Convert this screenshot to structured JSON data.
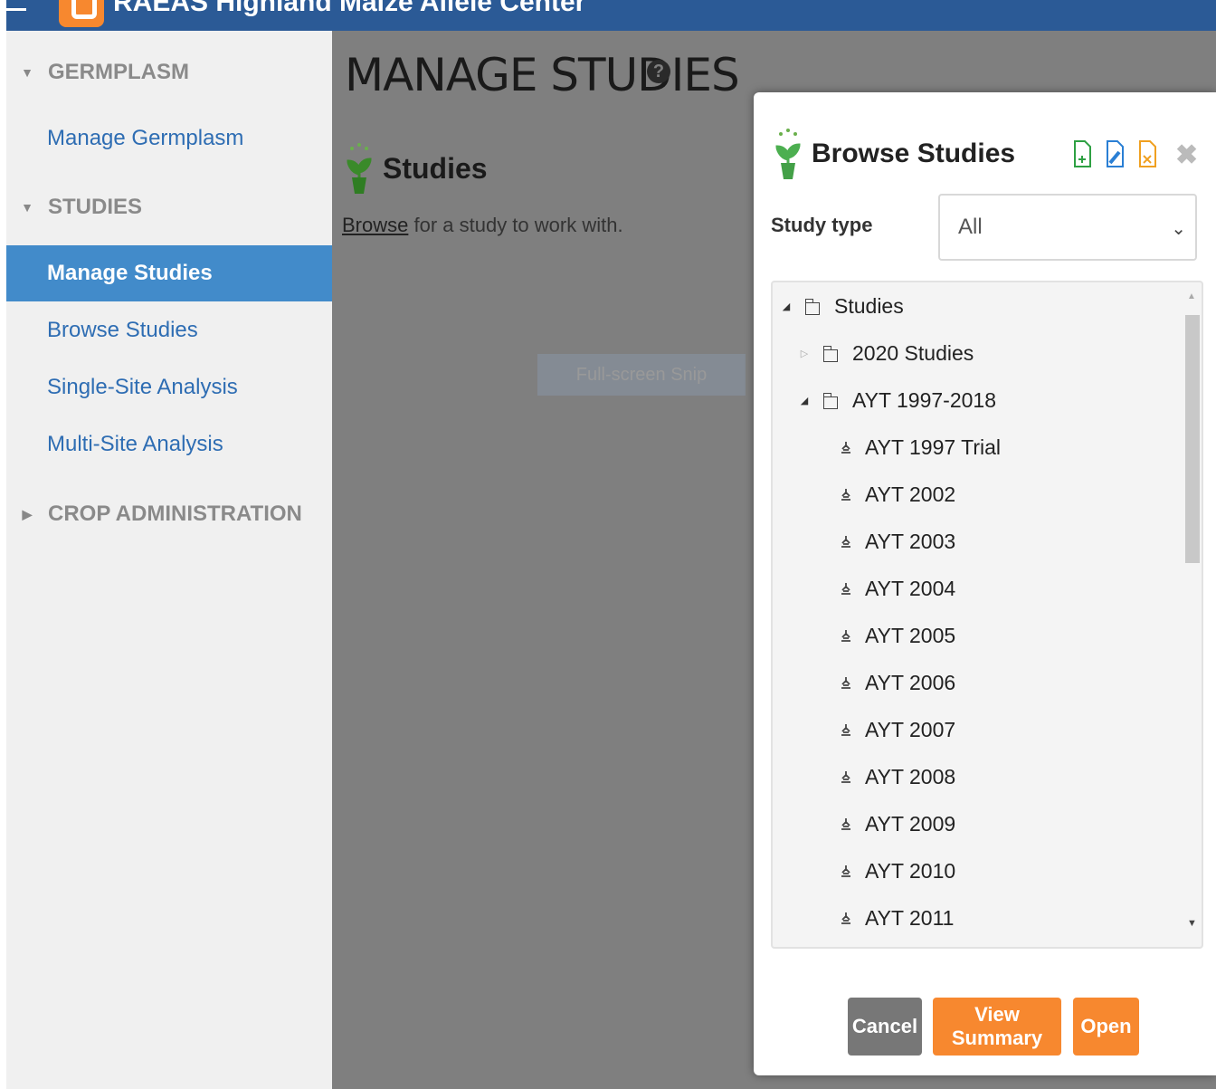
{
  "app": {
    "title": "RAEAS Highland Maize Allele Center"
  },
  "sidebar": {
    "sections": [
      {
        "label": "GERMPLASM",
        "expanded": true
      },
      {
        "label": "STUDIES",
        "expanded": true
      },
      {
        "label": "CROP ADMINISTRATION",
        "expanded": false
      }
    ],
    "links": [
      {
        "label": "Manage Germplasm",
        "active": false
      },
      {
        "label": "Manage Studies",
        "active": true
      },
      {
        "label": "Browse Studies",
        "active": false
      },
      {
        "label": "Single-Site Analysis",
        "active": false
      },
      {
        "label": "Multi-Site Analysis",
        "active": false
      }
    ]
  },
  "main": {
    "page_title": "MANAGE STUDIES",
    "help_icon": "question-circle-icon",
    "studies_title": "Studies",
    "browse_link": "Browse",
    "browse_rest": " for a study to work with.",
    "snip_label": "Full-screen Snip"
  },
  "modal": {
    "title": "Browse Studies",
    "tools": [
      "new-study-icon",
      "edit-study-icon",
      "delete-study-icon"
    ],
    "close_icon": "close-icon",
    "study_type_label": "Study type",
    "study_type_value": "All",
    "tree": [
      {
        "label": "Studies",
        "level": 0,
        "kind": "folder",
        "open": true
      },
      {
        "label": "2020 Studies",
        "level": 1,
        "kind": "folder",
        "open": false
      },
      {
        "label": "AYT 1997-2018",
        "level": 1,
        "kind": "folder",
        "open": true
      },
      {
        "label": "AYT 1997 Trial",
        "level": 2,
        "kind": "study"
      },
      {
        "label": "AYT 2002",
        "level": 2,
        "kind": "study"
      },
      {
        "label": "AYT 2003",
        "level": 2,
        "kind": "study"
      },
      {
        "label": "AYT 2004",
        "level": 2,
        "kind": "study"
      },
      {
        "label": "AYT 2005",
        "level": 2,
        "kind": "study"
      },
      {
        "label": "AYT 2006",
        "level": 2,
        "kind": "study"
      },
      {
        "label": "AYT 2007",
        "level": 2,
        "kind": "study"
      },
      {
        "label": "AYT 2008",
        "level": 2,
        "kind": "study"
      },
      {
        "label": "AYT 2009",
        "level": 2,
        "kind": "study"
      },
      {
        "label": "AYT 2010",
        "level": 2,
        "kind": "study"
      },
      {
        "label": "AYT 2011",
        "level": 2,
        "kind": "study"
      }
    ],
    "buttons": {
      "cancel": "Cancel",
      "view_summary": "View Summary",
      "open": "Open"
    }
  },
  "colors": {
    "header": "#2b5a96",
    "active_nav": "#428bca",
    "accent": "#f7882f",
    "link": "#2e6db3"
  }
}
